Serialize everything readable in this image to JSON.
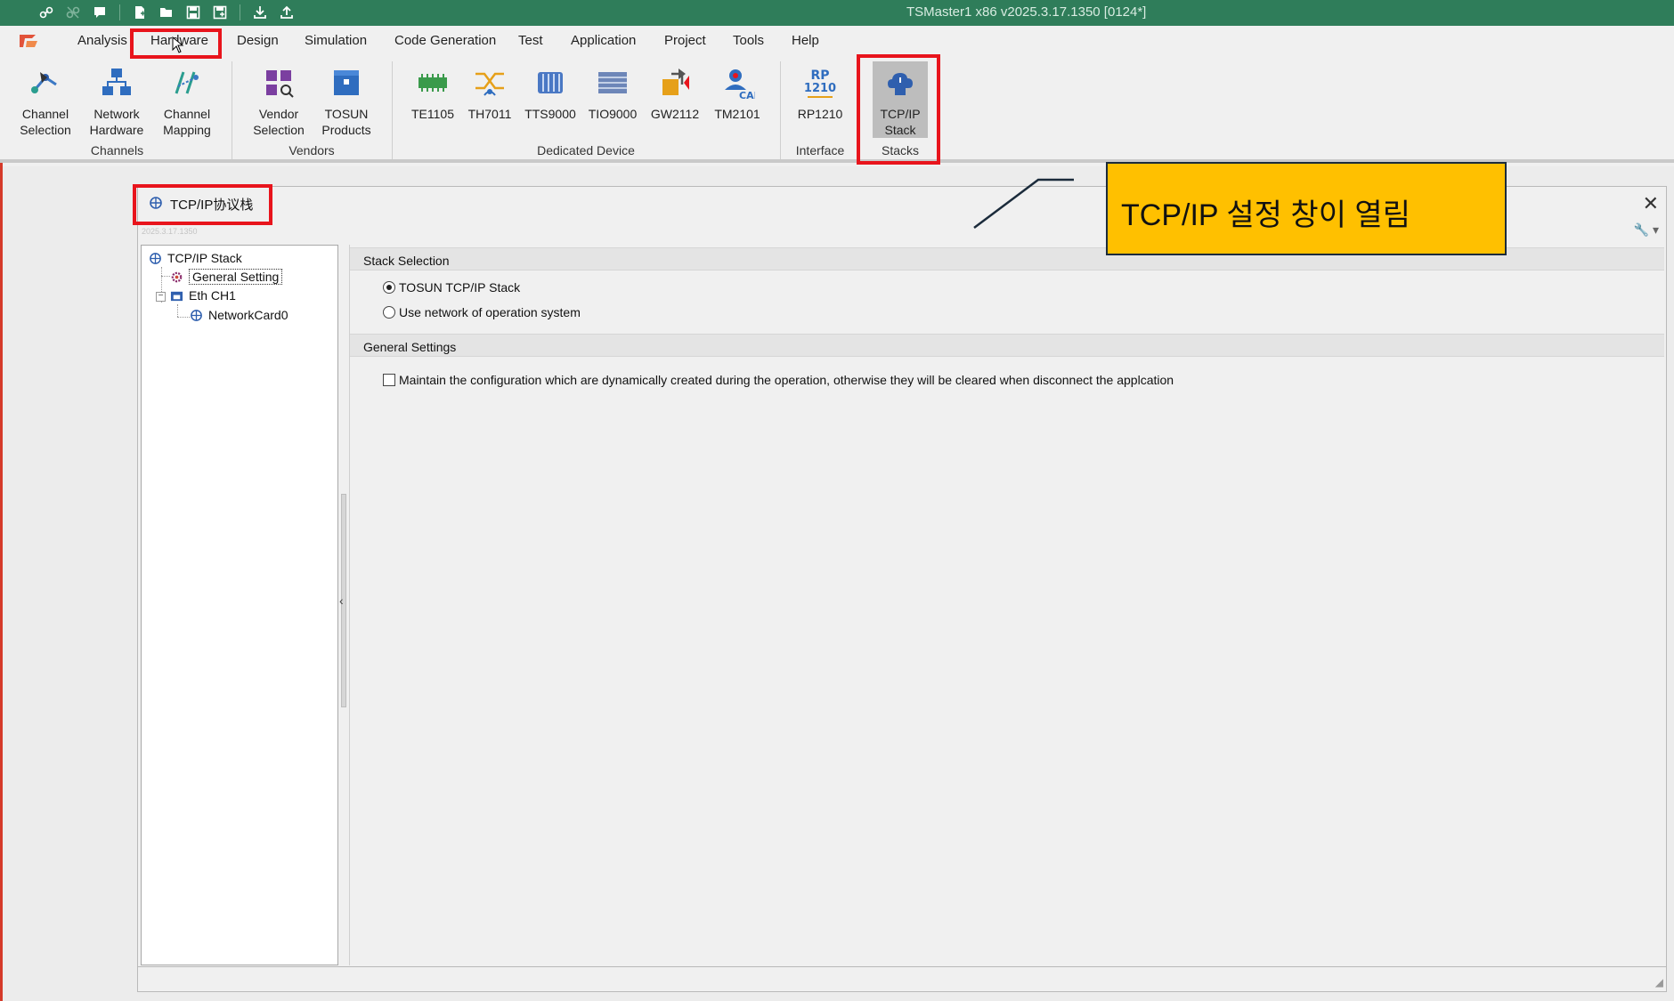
{
  "window": {
    "title": "TSMaster1 x86 v2025.3.17.1350 [0124*]"
  },
  "quick_access": [
    {
      "name": "link-icon",
      "glyph": "⛓"
    },
    {
      "name": "unlink-icon",
      "glyph": "⛓"
    },
    {
      "name": "comment-icon",
      "glyph": "▆"
    },
    {
      "name": "new-file-icon",
      "glyph": "🗋"
    },
    {
      "name": "open-folder-icon",
      "glyph": "🗁"
    },
    {
      "name": "save-icon",
      "glyph": "🖫"
    },
    {
      "name": "save-as-icon",
      "glyph": "🖫"
    },
    {
      "name": "import-icon",
      "glyph": "⤓"
    },
    {
      "name": "export-icon",
      "glyph": "⤒"
    }
  ],
  "menu": {
    "tabs": [
      "Analysis",
      "Hardware",
      "Design",
      "Simulation",
      "Code Generation",
      "Test",
      "Application",
      "Project",
      "Tools",
      "Help"
    ],
    "active": "Hardware"
  },
  "ribbon": {
    "channels": {
      "label": "Channels",
      "buttons": [
        {
          "l1": "Channel",
          "l2": "Selection"
        },
        {
          "l1": "Network",
          "l2": "Hardware"
        },
        {
          "l1": "Channel",
          "l2": "Mapping"
        }
      ]
    },
    "vendors": {
      "label": "Vendors",
      "buttons": [
        {
          "l1": "Vendor",
          "l2": "Selection"
        },
        {
          "l1": "TOSUN",
          "l2": "Products"
        }
      ]
    },
    "dedicated": {
      "label": "Dedicated Device",
      "buttons": [
        "TE1105",
        "TH7011",
        "TTS9000",
        "TIO9000",
        "GW2112",
        "TM2101"
      ]
    },
    "interface": {
      "label": "Interface",
      "button": "RP1210",
      "icon_text_top": "RP",
      "icon_text_bottom": "1210"
    },
    "stacks": {
      "label": "Stacks",
      "l1": "TCP/IP",
      "l2": "Stack"
    },
    "tm2101_badge": "CAN"
  },
  "dialog": {
    "title": "TCP/IP协议栈",
    "version": "2025.3.17.1350",
    "close_glyph": "✕",
    "tool_glyph": "🔧 ▾",
    "tree": {
      "root": "TCP/IP Stack",
      "general": "General Setting",
      "eth": "Eth CH1",
      "card": "NetworkCard0",
      "expander": "−"
    },
    "stack_selection": {
      "header": "Stack Selection",
      "options": [
        "TOSUN TCP/IP Stack",
        "Use network of operation system"
      ],
      "selected": 0
    },
    "general_settings": {
      "header": "General Settings",
      "checkbox_label": "Maintain the configuration which are dynamically created during the operation, otherwise they will be cleared when disconnect the applcation",
      "checked": false
    }
  },
  "callout": {
    "text": "TCP/IP 설정 창이 열림"
  },
  "colors": {
    "titlebar": "#2f7d5a",
    "highlight": "#e8141c",
    "callout": "#ffc000"
  }
}
